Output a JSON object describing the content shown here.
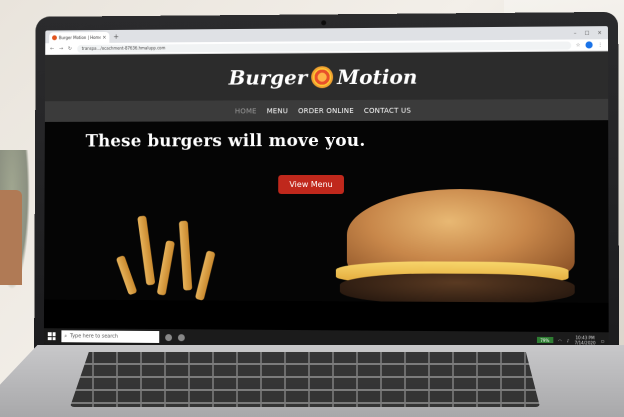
{
  "browser": {
    "tab_title": "Burger Motion | Home",
    "tab_close": "×",
    "new_tab": "+",
    "url": "transpa…/ocachment-87636.hmalupp.com",
    "controls": [
      "–",
      "□",
      "×"
    ]
  },
  "site": {
    "logo_left": "Burger",
    "logo_right": "Motion",
    "nav": [
      "HOME",
      "MENU",
      "ORDER ONLINE",
      "CONTACT US"
    ],
    "hero_heading": "These burgers will move you.",
    "cta_label": "View Menu"
  },
  "taskbar": {
    "search_placeholder": "Type here to search",
    "battery": "79%",
    "time": "10:43 PM",
    "date": "7/14/2020"
  },
  "colors": {
    "cta": "#c0281c",
    "header": "#2c2c2c",
    "nav": "#3b3b3b"
  }
}
